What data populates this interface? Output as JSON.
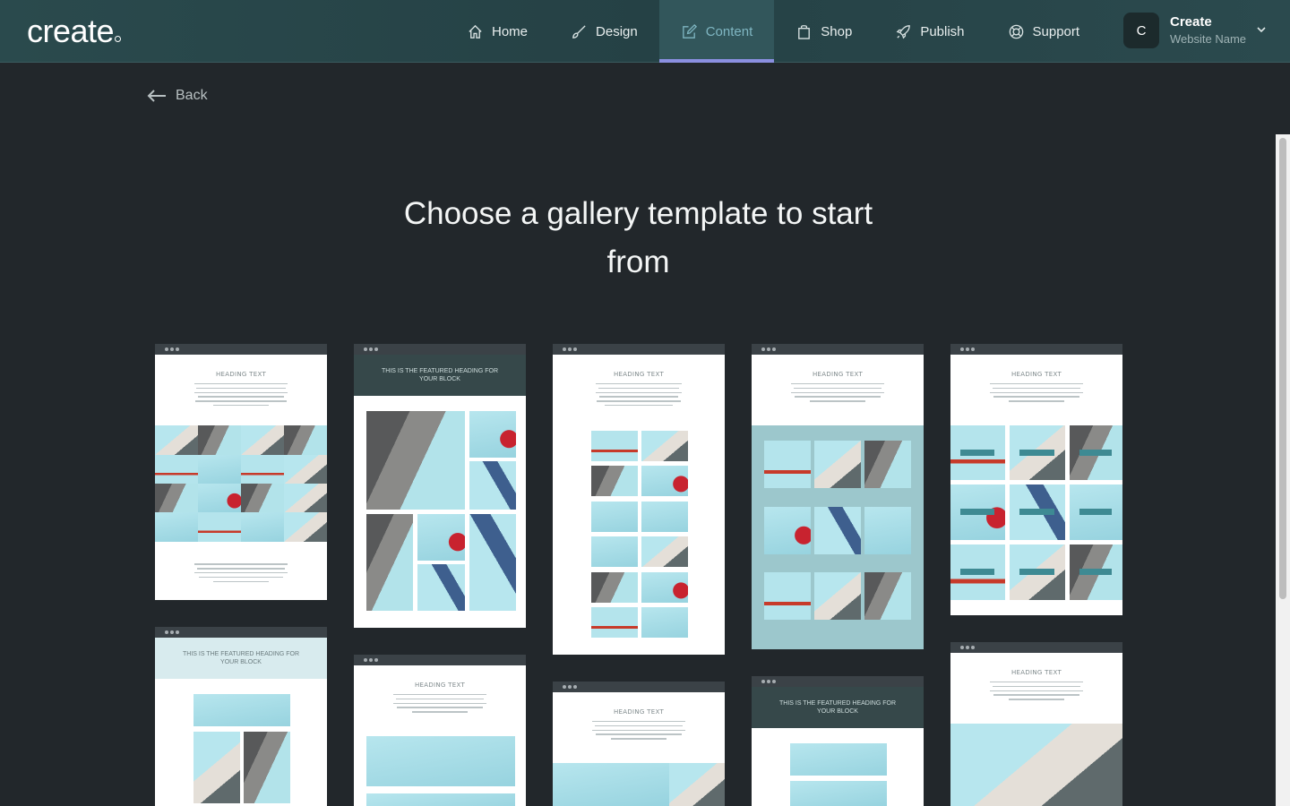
{
  "app": {
    "logo": "create"
  },
  "nav": {
    "items": [
      {
        "label": "Home",
        "icon": "home-icon"
      },
      {
        "label": "Design",
        "icon": "brush-icon"
      },
      {
        "label": "Content",
        "icon": "edit-icon"
      },
      {
        "label": "Shop",
        "icon": "bag-icon"
      },
      {
        "label": "Publish",
        "icon": "rocket-icon"
      },
      {
        "label": "Support",
        "icon": "lifebuoy-icon"
      }
    ],
    "active": "Content",
    "active_color": "#7fb6c2",
    "indicator_color": "#8a8fe0"
  },
  "account": {
    "initial": "C",
    "name": "Create",
    "site": "Website Name"
  },
  "page": {
    "back_label": "Back",
    "title": "Choose a gallery template to start from"
  },
  "templates": {
    "heading": "Heading Text",
    "featured": "This is the featured heading for your block"
  }
}
